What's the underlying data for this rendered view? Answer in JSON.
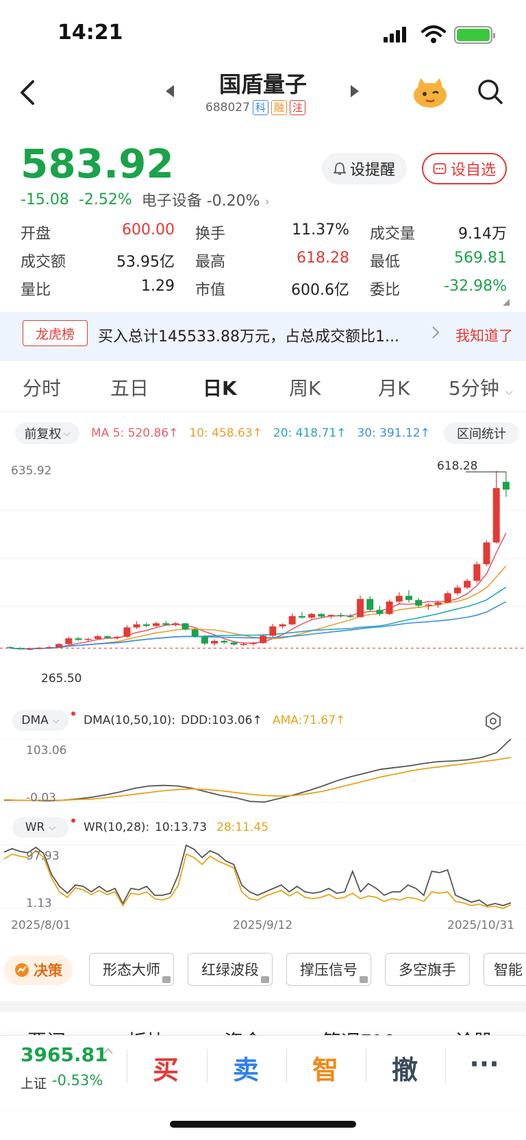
{
  "status": {
    "time": "14:21"
  },
  "header": {
    "title": "国盾量子",
    "code": "688027",
    "tags": [
      "科",
      "融",
      "注"
    ]
  },
  "quote": {
    "price": "583.92",
    "change": "-15.08",
    "change_pct": "-2.52%",
    "sector": "电子设备 -0.20%",
    "remind_label": "设提醒",
    "watch_label": "设自选"
  },
  "stats": [
    [
      {
        "label": "开盘",
        "value": "600.00",
        "color": "red"
      },
      {
        "label": "换手",
        "value": "11.37%",
        "color": "dark"
      },
      {
        "label": "成交量",
        "value": "9.14万",
        "color": "dark"
      }
    ],
    [
      {
        "label": "成交额",
        "value": "53.95亿",
        "color": "dark"
      },
      {
        "label": "最高",
        "value": "618.28",
        "color": "red"
      },
      {
        "label": "最低",
        "value": "569.81",
        "color": "green"
      }
    ],
    [
      {
        "label": "量比",
        "value": "1.29",
        "color": "dark"
      },
      {
        "label": "市值",
        "value": "600.6亿",
        "color": "dark"
      },
      {
        "label": "委比",
        "value": "-32.98%",
        "color": "green"
      }
    ]
  ],
  "news": {
    "badge": "龙虎榜",
    "text": "买入总计145533.88万元，占总成交额比1...",
    "dismiss": "我知道了"
  },
  "tabs": [
    "分时",
    "五日",
    "日K",
    "周K",
    "月K",
    "5分钟"
  ],
  "active_tab": "日K",
  "kline_controls": {
    "adjust": "前复权",
    "range_stat": "区间统计",
    "ma": {
      "ma5": "MA 5: 520.86↑",
      "ma10": "10: 458.63↑",
      "ma20": "20: 418.71↑",
      "ma30": "30: 391.12↑"
    },
    "colors": {
      "ma5": "#e85d6b",
      "ma10": "#e8a030",
      "ma20": "#2aa7b8",
      "ma30": "#3d8fe0",
      "up": "#e53935",
      "down": "#1aa34a"
    }
  },
  "chart_data": [
    {
      "type": "candlestick",
      "x_dates": [
        "2025/8/01",
        "2025/9/12",
        "2025/10/31"
      ],
      "ylim": [
        265.5,
        635.92
      ],
      "axis_top_label": "635.92",
      "high_label": "618.28",
      "low_label": "265.50",
      "ohlc": [
        [
          280,
          282,
          277,
          278
        ],
        [
          278,
          280,
          275,
          276
        ],
        [
          276,
          279,
          274,
          277
        ],
        [
          277,
          280,
          276,
          279
        ],
        [
          279,
          282,
          277,
          280
        ],
        [
          280,
          288,
          278,
          286
        ],
        [
          286,
          300,
          285,
          297
        ],
        [
          297,
          300,
          292,
          294
        ],
        [
          294,
          298,
          291,
          296
        ],
        [
          296,
          304,
          294,
          301
        ],
        [
          301,
          303,
          296,
          298
        ],
        [
          298,
          302,
          295,
          300
        ],
        [
          300,
          322,
          298,
          318
        ],
        [
          318,
          330,
          315,
          324
        ],
        [
          324,
          327,
          318,
          321
        ],
        [
          321,
          329,
          319,
          326
        ],
        [
          326,
          330,
          321,
          323
        ],
        [
          323,
          328,
          320,
          326
        ],
        [
          326,
          327,
          312,
          314
        ],
        [
          314,
          316,
          298,
          300
        ],
        [
          300,
          303,
          284,
          287
        ],
        [
          287,
          295,
          283,
          292
        ],
        [
          292,
          294,
          286,
          289
        ],
        [
          289,
          292,
          283,
          285
        ],
        [
          285,
          289,
          282,
          286
        ],
        [
          286,
          290,
          283,
          288
        ],
        [
          288,
          305,
          286,
          302
        ],
        [
          302,
          325,
          300,
          320
        ],
        [
          320,
          326,
          316,
          324
        ],
        [
          324,
          345,
          322,
          340
        ],
        [
          340,
          348,
          335,
          337
        ],
        [
          337,
          346,
          334,
          344
        ],
        [
          344,
          346,
          336,
          339
        ],
        [
          339,
          344,
          335,
          342
        ],
        [
          342,
          346,
          337,
          340
        ],
        [
          340,
          344,
          336,
          338
        ],
        [
          338,
          380,
          337,
          373
        ],
        [
          373,
          378,
          348,
          352
        ],
        [
          352,
          360,
          340,
          344
        ],
        [
          344,
          372,
          342,
          368
        ],
        [
          368,
          386,
          362,
          379
        ],
        [
          379,
          390,
          366,
          371
        ],
        [
          371,
          375,
          356,
          360
        ],
        [
          360,
          365,
          352,
          362
        ],
        [
          362,
          370,
          356,
          366
        ],
        [
          366,
          388,
          364,
          384
        ],
        [
          384,
          400,
          380,
          395
        ],
        [
          395,
          412,
          392,
          408
        ],
        [
          408,
          445,
          404,
          440
        ],
        [
          440,
          486,
          436,
          482
        ],
        [
          482,
          620,
          480,
          587
        ],
        [
          599,
          618,
          570,
          584
        ]
      ]
    },
    {
      "type": "line",
      "name": "DMA",
      "params": "DMA(10,50,10):",
      "ddd_label": "DDD:103.06↑",
      "ama_label": "AMA:71.67↑",
      "y_top": "103.06",
      "y_bottom": "-0.03",
      "series": [
        {
          "name": "DDD",
          "values": [
            0,
            0,
            0,
            -1,
            0,
            2,
            5,
            9,
            14,
            20,
            24,
            25,
            24,
            20,
            14,
            8,
            4,
            -2,
            -3,
            3,
            9,
            16,
            24,
            33,
            40,
            46,
            52,
            55,
            58,
            62,
            65,
            66,
            68,
            72,
            80,
            103
          ]
        },
        {
          "name": "AMA",
          "values": [
            1,
            0,
            0,
            0,
            0,
            1,
            2,
            4,
            7,
            10,
            13,
            16,
            18,
            19,
            18,
            16,
            13,
            10,
            8,
            7,
            8,
            11,
            15,
            21,
            27,
            33,
            39,
            44,
            49,
            53,
            56,
            59,
            62,
            65,
            68,
            72
          ]
        }
      ]
    },
    {
      "type": "line",
      "name": "WR",
      "params": "WR(10,28):",
      "wr10_label": "10:13.73",
      "wr28_label": "28:11.45",
      "y_top": "97.93",
      "y_bottom": "1.13",
      "series": [
        {
          "name": "10",
          "values": [
            88,
            93,
            89,
            87,
            95,
            86,
            55,
            38,
            28,
            40,
            38,
            30,
            38,
            30,
            35,
            13,
            35,
            33,
            38,
            25,
            25,
            28,
            55,
            98,
            92,
            80,
            90,
            85,
            75,
            70,
            40,
            30,
            25,
            30,
            35,
            40,
            30,
            38,
            30,
            28,
            30,
            35,
            28,
            30,
            60,
            30,
            42,
            35,
            25,
            30,
            30,
            40,
            35,
            25,
            60,
            58,
            62,
            25,
            20,
            15,
            18,
            10,
            13,
            10,
            14
          ]
        },
        {
          "name": "28",
          "values": [
            78,
            85,
            82,
            80,
            90,
            80,
            50,
            30,
            22,
            36,
            33,
            26,
            32,
            26,
            30,
            10,
            28,
            26,
            30,
            20,
            18,
            22,
            40,
            85,
            80,
            70,
            82,
            75,
            70,
            65,
            30,
            20,
            18,
            24,
            28,
            32,
            24,
            30,
            22,
            20,
            22,
            26,
            20,
            22,
            28,
            20,
            24,
            22,
            16,
            20,
            18,
            22,
            20,
            16,
            30,
            28,
            30,
            16,
            14,
            10,
            12,
            8,
            9,
            6,
            11
          ]
        }
      ]
    }
  ],
  "indicators": {
    "dma_pill": "DMA",
    "wr_pill": "WR"
  },
  "tools": {
    "decision": "决策",
    "items": [
      "形态大师",
      "红绿波段",
      "撑压信号",
      "多空旗手",
      "智能"
    ]
  },
  "lower_tabs": [
    "要闻",
    "板块",
    "资金",
    "简况F10",
    "诊股"
  ],
  "bottom_bar": {
    "index_value": "3965.81",
    "index_name": "上证",
    "index_change": "-0.53%",
    "actions": [
      {
        "label": "买",
        "color": "#e53935"
      },
      {
        "label": "卖",
        "color": "#2f80ed"
      },
      {
        "label": "智",
        "color": "#f08a1a"
      },
      {
        "label": "撤",
        "color": "#3a4a5c"
      },
      {
        "label": "···",
        "color": "#3a4a5c"
      }
    ]
  }
}
